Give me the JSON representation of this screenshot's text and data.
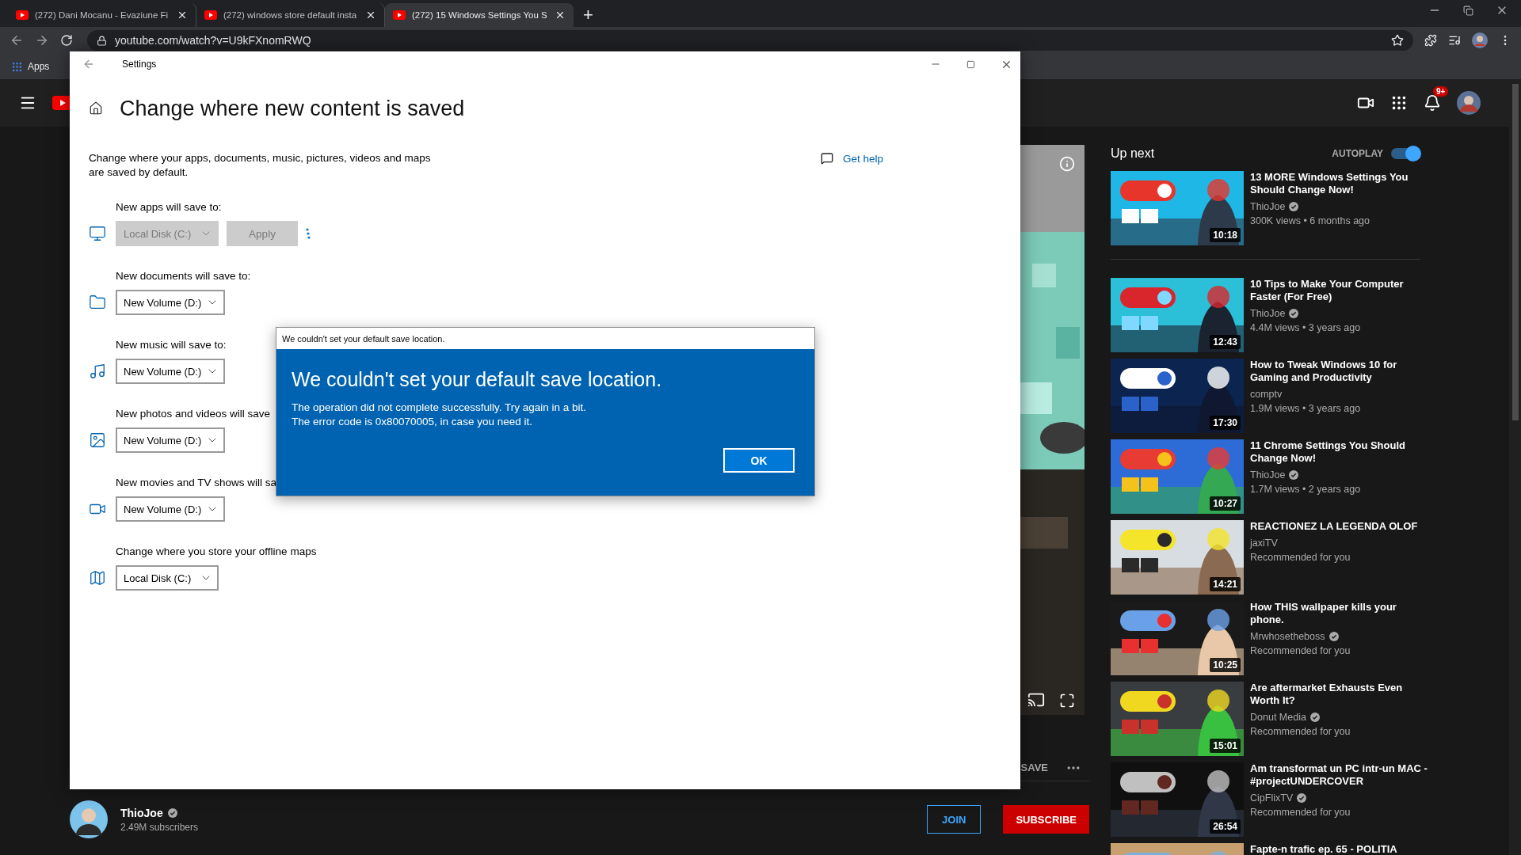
{
  "browser": {
    "tabs": [
      {
        "title": "(272) Dani Mocanu - Evaziune Fi",
        "selected": false
      },
      {
        "title": "(272) windows store default insta",
        "selected": false
      },
      {
        "title": "(272) 15 Windows Settings You S",
        "selected": true
      }
    ],
    "new_tab": "+",
    "url": "youtube.com/watch?v=U9kFXnomRWQ",
    "bookmarks": [
      "Apps"
    ]
  },
  "youtube": {
    "notification_count": "9+",
    "player_actions": [
      "SAVE"
    ],
    "channel": {
      "name": "ThioJoe",
      "verified": true,
      "subscribers": "2.49M subscribers"
    },
    "join": "JOIN",
    "subscribe": "SUBSCRIBE",
    "up_next": "Up next",
    "autoplay": {
      "label": "AUTOPLAY",
      "on": true
    },
    "autoplay_video": {
      "title": "13 MORE Windows Settings You Should Change Now!",
      "channel": "ThioJoe",
      "verified": true,
      "meta": "300K views • 6 months ago",
      "duration": "10:18"
    },
    "videos": [
      {
        "title": "10 Tips to Make Your Computer Faster (For Free)",
        "channel": "ThioJoe",
        "verified": true,
        "meta": "4.4M views • 3 years ago",
        "duration": "12:43"
      },
      {
        "title": "How to Tweak Windows 10 for Gaming and Productivity",
        "channel": "comptv",
        "verified": false,
        "meta": "1.9M views • 3 years ago",
        "duration": "17:30"
      },
      {
        "title": "11 Chrome Settings You Should Change Now!",
        "channel": "ThioJoe",
        "verified": true,
        "meta": "1.7M views • 2 years ago",
        "duration": "10:27"
      },
      {
        "title": "REACTIONEZ LA LEGENDA OLOF",
        "channel": "jaxiTV",
        "verified": false,
        "meta": "Recommended for you",
        "duration": "14:21"
      },
      {
        "title": "How THIS wallpaper kills your phone.",
        "channel": "Mrwhosetheboss",
        "verified": true,
        "meta": "Recommended for you",
        "duration": "10:25"
      },
      {
        "title": "Are aftermarket Exhausts Even Worth It?",
        "channel": "Donut Media",
        "verified": true,
        "meta": "Recommended for you",
        "duration": "15:01"
      },
      {
        "title": "Am transformat un PC intr-un MAC - #projectUNDERCOVER",
        "channel": "CipFlixTV",
        "verified": true,
        "meta": "Recommended for you",
        "duration": "26:54"
      },
      {
        "title": "Fapte-n trafic ep. 65 - POLITIA"
      }
    ]
  },
  "settings": {
    "title": "Settings",
    "heading": "Change where new content is saved",
    "description": "Change where your apps, documents, music, pictures, videos and maps are saved by default.",
    "get_help": "Get help",
    "items": [
      {
        "label": "New apps will save to:",
        "kind": "apps",
        "value": "Local Disk (C:)",
        "disabled": true,
        "apply": {
          "label": "Apply",
          "disabled": true
        },
        "busy": true
      },
      {
        "label": "New documents will save to:",
        "kind": "documents",
        "value": "New Volume (D:)",
        "disabled": false
      },
      {
        "label": "New music will save to:",
        "kind": "music",
        "value": "New Volume (D:)",
        "disabled": false
      },
      {
        "label": "New photos and videos will save",
        "kind": "photos",
        "value": "New Volume (D:)",
        "disabled": false
      },
      {
        "label": "New movies and TV shows will sa",
        "kind": "movies",
        "value": "New Volume (D:)",
        "disabled": false
      },
      {
        "label": "Change where you store your offline maps",
        "kind": "maps",
        "value": "Local Disk (C:)",
        "disabled": false
      }
    ]
  },
  "dialog": {
    "caption": "We couldn't set your default save location.",
    "heading": "We couldn't set your default save location.",
    "lines": [
      "The operation did not complete successfully. Try again in a bit.",
      "The error code is 0x80070005, in case you need it."
    ],
    "ok": "OK"
  }
}
